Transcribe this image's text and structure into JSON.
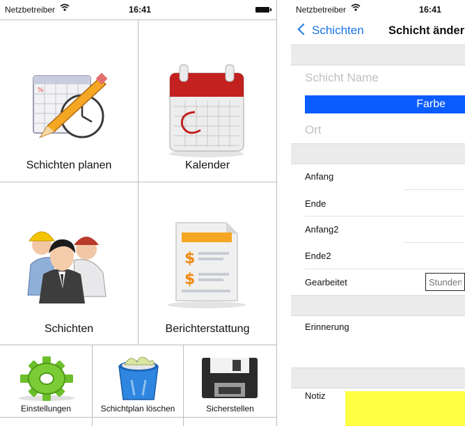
{
  "left_phone": {
    "status": {
      "carrier": "Netzbetreiber",
      "time": "16:41"
    },
    "tiles": [
      {
        "label": "Schichten planen",
        "icon": "calendar-pencil-clock-icon"
      },
      {
        "label": "Kalender",
        "icon": "calendar-icon"
      },
      {
        "label": "Schichten",
        "icon": "workers-icon"
      },
      {
        "label": "Berichterstattung",
        "icon": "report-document-icon"
      }
    ],
    "small_tiles": [
      {
        "label": "Einstellungen",
        "icon": "gear-icon"
      },
      {
        "label": "Schichtplan löschen",
        "icon": "trash-bin-icon"
      },
      {
        "label": "Sicherstellen",
        "icon": "floppy-disk-icon"
      }
    ]
  },
  "right_phone": {
    "status": {
      "carrier": "Netzbetreiber",
      "time": "16:41"
    },
    "nav": {
      "back_label": "Schichten",
      "title": "Schicht ändern"
    },
    "fields": {
      "name_placeholder": "Schicht Name",
      "color_label": "Farbe",
      "color_value": "#0a5cff",
      "location_placeholder": "Ort"
    },
    "rows": {
      "start": "Anfang",
      "end": "Ende",
      "start2": "Anfang2",
      "end2": "Ende2",
      "worked": "Gearbeitet",
      "worked_placeholder": "Stunden",
      "reminder": "Erinnerung",
      "note": "Notiz"
    },
    "note_color": "#ffff44"
  }
}
